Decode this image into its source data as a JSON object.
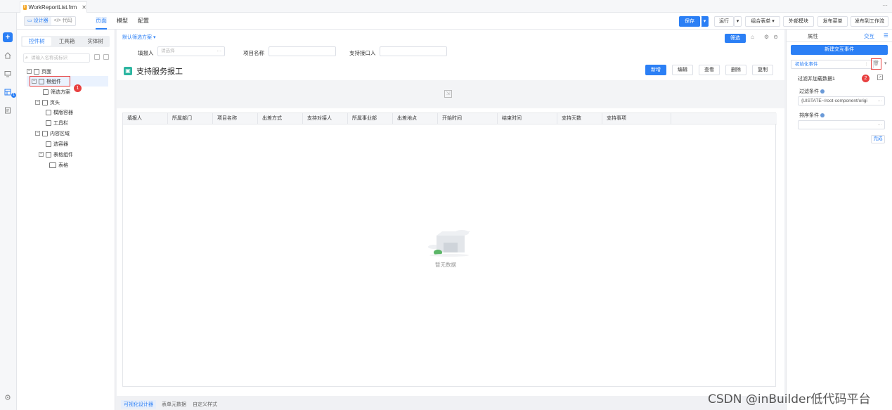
{
  "file_tab": {
    "name": "WorkReportList.frm",
    "icon": "frm-file-icon",
    "close": "✕"
  },
  "window_more": "···",
  "mode_toggle": {
    "designer": "设计器",
    "code": "代码"
  },
  "view_tabs": [
    {
      "label": "页面",
      "active": true
    },
    {
      "label": "模型",
      "active": false
    },
    {
      "label": "配置",
      "active": false
    }
  ],
  "toolbar": {
    "save": "保存",
    "run": "运行",
    "combo_form": "组合表单",
    "external_ref": "外部模块",
    "publish_menu": "发布菜单",
    "publish_workflow": "发布到工作流"
  },
  "tree_panel": {
    "tabs": [
      {
        "label": "控件树",
        "active": true
      },
      {
        "label": "工具箱",
        "active": false
      },
      {
        "label": "实体树",
        "active": false
      }
    ],
    "search_placeholder": "请输入名称或标识",
    "nodes": [
      {
        "label": "页面",
        "icon": "page-icon"
      },
      {
        "label": "根组件",
        "icon": "component-icon"
      },
      {
        "label": "筛选方案",
        "icon": "filter-scheme-icon"
      },
      {
        "label": "页头",
        "icon": "header-icon"
      },
      {
        "label": "模版容器",
        "icon": "template-container-icon"
      },
      {
        "label": "工具栏",
        "icon": "toolbar-icon"
      },
      {
        "label": "内容区域",
        "icon": "content-area-icon"
      },
      {
        "label": "选容器",
        "icon": "container-icon"
      },
      {
        "label": "表格组件",
        "icon": "grid-component-icon"
      },
      {
        "label": "表格",
        "icon": "table-icon"
      }
    ]
  },
  "markers": {
    "one": "1",
    "two": "2"
  },
  "canvas": {
    "filter_scheme": "默认筛选方案 ▾",
    "filters": [
      {
        "label": "填报人",
        "placeholder": "请选择"
      },
      {
        "label": "项目名称",
        "placeholder": ""
      },
      {
        "label": "支持接口人",
        "placeholder": ""
      }
    ],
    "filter_button": "筛选",
    "form_title": "支持服务报工",
    "actions": [
      "新增",
      "编辑",
      "查看",
      "删除",
      "复制"
    ],
    "columns": [
      "填报人",
      "所属部门",
      "项目名称",
      "出差方式",
      "支持对接人",
      "所属事业部",
      "出差地点",
      "开始时间",
      "结束时间",
      "支持天数",
      "支持事项"
    ],
    "empty_text": "暂无数据"
  },
  "bottom_tabs": [
    "可视化设计器",
    "表单元数据",
    "自定义样式"
  ],
  "right_panel": {
    "tabs": [
      {
        "label": "属性",
        "active": false
      },
      {
        "label": "交互",
        "active": true
      }
    ],
    "new_event": "新建交互事件",
    "event_select": "初始化事件",
    "event_name": "过滤并加载数据1",
    "filter_label": "过滤条件",
    "filter_value": "{UISTATE~/root-component/origi",
    "sort_label": "排序条件",
    "sort_value": "",
    "done": "完成"
  },
  "watermark": "CSDN @inBuilder低代码平台",
  "colors": {
    "accent": "#2b7ff5",
    "marker": "#e84040"
  }
}
